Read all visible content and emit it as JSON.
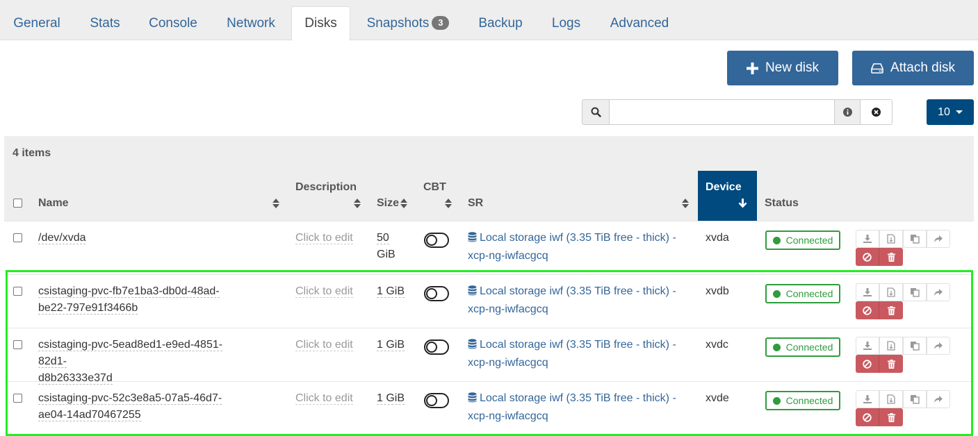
{
  "tabs": [
    {
      "label": "General"
    },
    {
      "label": "Stats"
    },
    {
      "label": "Console"
    },
    {
      "label": "Network"
    },
    {
      "label": "Disks"
    },
    {
      "label": "Snapshots",
      "badge": "3"
    },
    {
      "label": "Backup"
    },
    {
      "label": "Logs"
    },
    {
      "label": "Advanced"
    }
  ],
  "active_tab": "Disks",
  "actions": {
    "new_disk": "New disk",
    "attach_disk": "Attach disk"
  },
  "filter": {
    "placeholder": "",
    "value": ""
  },
  "page_size": "10",
  "table": {
    "items_count": "4 items",
    "columns": {
      "name": "Name",
      "description": "Description",
      "size": "Size",
      "cbt": "CBT",
      "sr": "SR",
      "device": "Device",
      "status": "Status"
    },
    "sorted_column": "Device",
    "rows": [
      {
        "name_line1": "/dev/xvda",
        "name_line2": "",
        "description": "Click to edit",
        "size_line1": "50",
        "size_line2": "GiB",
        "cbt_enabled": false,
        "sr_line1": "Local storage iwf (3.35 TiB free - thick) -",
        "sr_line2": "xcp-ng-iwfacgcq",
        "device": "xvda",
        "status": "Connected"
      },
      {
        "name_line1": "csistaging-pvc-fb7e1ba3-db0d-48ad-",
        "name_line2": "be22-797e91f3466b",
        "description": "Click to edit",
        "size_line1": "1 GiB",
        "size_line2": "",
        "cbt_enabled": false,
        "sr_line1": "Local storage iwf (3.35 TiB free - thick) -",
        "sr_line2": "xcp-ng-iwfacgcq",
        "device": "xvdb",
        "status": "Connected"
      },
      {
        "name_line1": "csistaging-pvc-5ead8ed1-e9ed-4851-82d1-",
        "name_line2": "d8b26333e37d",
        "description": "Click to edit",
        "size_line1": "1 GiB",
        "size_line2": "",
        "cbt_enabled": false,
        "sr_line1": "Local storage iwf (3.35 TiB free - thick) -",
        "sr_line2": "xcp-ng-iwfacgcq",
        "device": "xvdc",
        "status": "Connected"
      },
      {
        "name_line1": "csistaging-pvc-52c3e8a5-07a5-46d7-",
        "name_line2": "ae04-14ad70467255",
        "description": "Click to edit",
        "size_line1": "1 GiB",
        "size_line2": "",
        "cbt_enabled": false,
        "sr_line1": "Local storage iwf (3.35 TiB free - thick) -",
        "sr_line2": "xcp-ng-iwfacgcq",
        "device": "xvde",
        "status": "Connected"
      }
    ]
  },
  "row_action_icons": [
    "download-icon",
    "import-file-icon",
    "copy-icon",
    "share-icon",
    "disconnect-icon",
    "trash-icon"
  ],
  "colors": {
    "primary": "#336699",
    "primary_dark": "#004a80",
    "connected": "#2f9c3d",
    "danger": "#c9595f",
    "selection_highlight": "#22ee22"
  }
}
